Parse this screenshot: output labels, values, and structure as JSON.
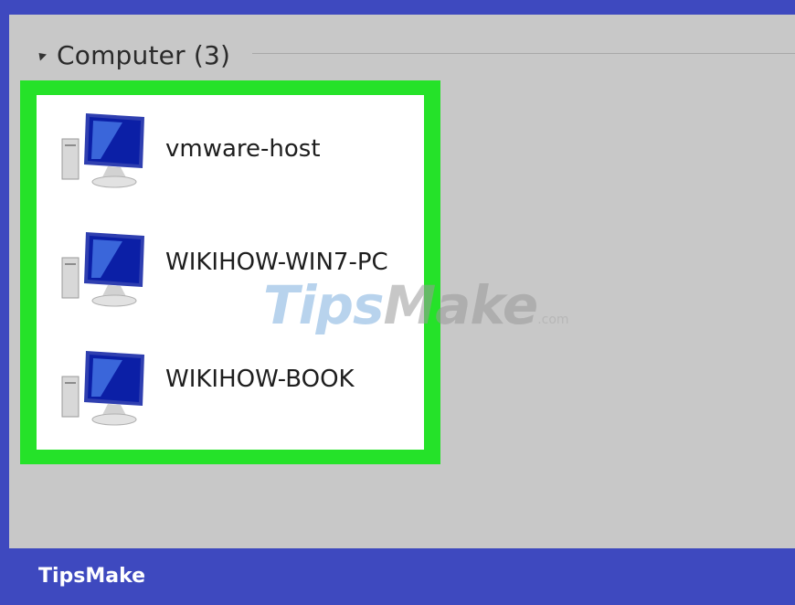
{
  "group": {
    "title": "Computer (3)",
    "arrow_icon": "collapse-arrow-icon"
  },
  "computers": [
    {
      "name": "vmware-host",
      "icon": "computer-icon"
    },
    {
      "name": "WIKIHOW-WIN7-PC",
      "icon": "computer-icon"
    },
    {
      "name": "WIKIHOW-BOOK",
      "icon": "computer-icon"
    }
  ],
  "watermark": {
    "part_a": "Tips",
    "part_b": "Make",
    "suffix": ".com"
  },
  "footer": {
    "brand": "TipsMake"
  },
  "colors": {
    "frame": "#3e49bf",
    "panel": "#c8c8c8",
    "highlight": "#25e229",
    "list_bg": "#ffffff"
  }
}
